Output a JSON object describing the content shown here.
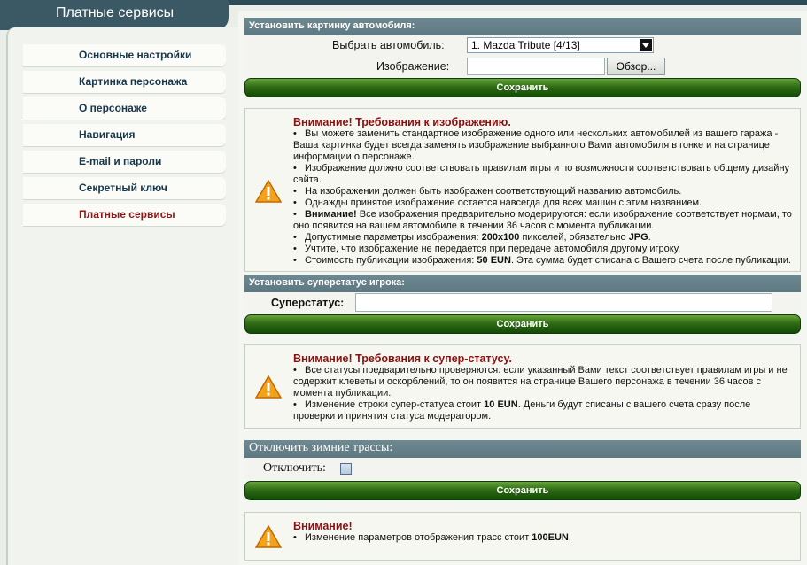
{
  "sidebar": {
    "title": "Платные сервисы",
    "items": [
      {
        "label": "Основные настройки"
      },
      {
        "label": "Картинка персонажа"
      },
      {
        "label": "О персонаже"
      },
      {
        "label": "Навигация"
      },
      {
        "label": "E-mail и пароли"
      },
      {
        "label": "Секретный ключ"
      },
      {
        "label": "Платные сервисы",
        "active": true
      }
    ]
  },
  "car_image": {
    "header": "Установить картинку автомобиля:",
    "car_label": "Выбрать автомобиль:",
    "car_selected": "1. Mazda Tribute [4/13]",
    "image_label": "Изображение:",
    "image_value": "",
    "browse_label": "Обзор...",
    "save_label": "Сохранить"
  },
  "warning_image": {
    "title": "Внимание! Требования к изображению.",
    "bullets": [
      "Вы можете заменить стандартное изображение одного или нескольких автомобилей из вашего гаража - Ваша картинка будет всегда заменять изображение выбранного Вами автомобиля в гонке и на странице информации о персонаже.",
      "Изображение должно соответствовать правилам игры и по возможности соответствовать общему дизайну сайта.",
      "На изображении должен быть изображен соответствующий названию автомобиль.",
      "Однажды принятое изображение остается навсегда для всех машин с этим названием.",
      "<b>Внимание!</b> Все изображения предварительно модерируются: если изображение соответствует нормам, то оно появится на вашем автомобиле в течении 36 часов с момента публикации.",
      "Допустимые параметры изображения: <b>200x100</b> пикселей, обязательно <b>JPG</b>.",
      "Учтите, что изображение не передается при передаче автомобиля другому игроку.",
      "Стоимость публикации изображения: <b>50 EUN</b>. Эта сумма будет списана с Вашего счета после публикации."
    ]
  },
  "superstatus": {
    "header": "Установить суперстатус игрока:",
    "label": "Суперстатус:",
    "value": "",
    "save_label": "Сохранить"
  },
  "warning_status": {
    "title": "Внимание! Требования к супер-статусу.",
    "bullets": [
      "Все статусы предварительно проверяются: если указанный Вами текст соответствует правилам игры и не содержит клеветы и оскорблений, то он появится на странице Вашего персонажа в течении 36 часов с момента публикации.",
      "Изменение строки супер-статуса стоит <b>10 EUN</b>. Деньги будут списаны с вашего счета сразу после проверки и принятия статуса модератором."
    ]
  },
  "winter": {
    "header": "Отключить зимние трассы:",
    "label": "Отключить:",
    "checked": false,
    "save_label": "Сохранить"
  },
  "warning_winter": {
    "title": "Внимание!",
    "bullets": [
      "Изменение параметров отображения трасс стоит <b>100EUN</b>."
    ]
  },
  "colors": {
    "header_bg": "#5d7880",
    "save_green": "#2f6c14",
    "warning_red": "#8a1010",
    "active_menu": "#8a1818"
  }
}
